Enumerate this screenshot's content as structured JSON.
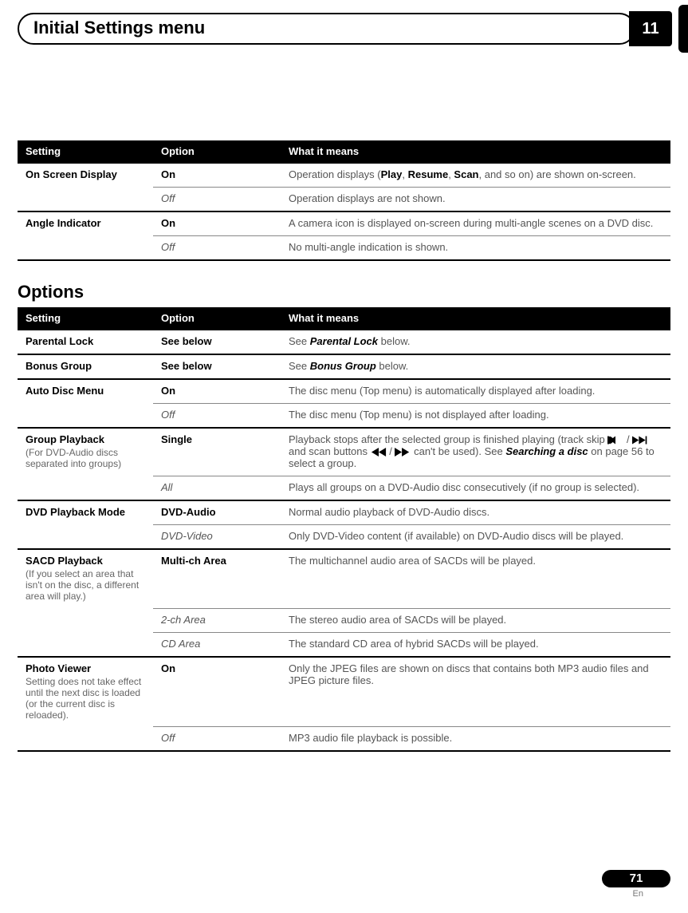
{
  "header": {
    "title": "Initial Settings menu",
    "chapter": "11"
  },
  "table1": {
    "headers": [
      "Setting",
      "Option",
      "What it means"
    ],
    "rows": [
      {
        "setting": "On Screen Display",
        "option": "On",
        "opt_style": "default",
        "meaning_pre": "Operation displays (",
        "b1": "Play",
        "sep1": ", ",
        "b2": "Resume",
        "sep2": ", ",
        "b3": "Scan",
        "meaning_post": ", and so on) are shown on-screen.",
        "new_section": true
      },
      {
        "setting": "",
        "option": "Off",
        "opt_style": "italic",
        "meaning": "Operation displays are not shown.",
        "inner": true
      },
      {
        "setting": "Angle Indicator",
        "option": "On",
        "opt_style": "default",
        "meaning": "A camera icon is displayed on-screen during multi-angle scenes on a DVD disc.",
        "new_section": true
      },
      {
        "setting": "",
        "option": "Off",
        "opt_style": "italic",
        "meaning": "No multi-angle indication is shown.",
        "inner": true
      }
    ]
  },
  "options_heading": "Options",
  "table2": {
    "headers": [
      "Setting",
      "Option",
      "What it means"
    ],
    "rows": [
      {
        "setting": "Parental Lock",
        "option": "See below",
        "opt_style": "default",
        "meaning_pre": "See ",
        "bi": "Parental Lock",
        "meaning_post": " below.",
        "new_section": true
      },
      {
        "setting": "Bonus Group",
        "option": "See below",
        "opt_style": "default",
        "meaning_pre": "See ",
        "bi": "Bonus Group",
        "meaning_post": " below.",
        "new_section": true
      },
      {
        "setting": "Auto Disc Menu",
        "option": "On",
        "opt_style": "default",
        "meaning": "The disc menu (Top menu) is automatically displayed after loading.",
        "new_section": true
      },
      {
        "setting": "",
        "option": "Off",
        "opt_style": "italic",
        "meaning": "The disc menu (Top menu) is not displayed after loading.",
        "inner": true
      },
      {
        "setting": "Group Playback",
        "setting_sub": "(For DVD-Audio discs separated into groups)",
        "option": "Single",
        "opt_style": "default",
        "meaning_pre": "Playback stops after the selected group is finished playing (track skip ",
        "icon1": "skip-back-icon",
        "sep1": " / ",
        "icon2": "skip-fwd-icon",
        "mid": " and scan buttons ",
        "icon3": "scan-back-icon",
        "sep2": " / ",
        "icon4": "scan-fwd-icon",
        "post1": " can't be used). See ",
        "bi": "Searching a disc",
        "post2": " on page 56 to select a group.",
        "new_section": true
      },
      {
        "setting": "",
        "option": "All",
        "opt_style": "italic",
        "meaning": "Plays all groups on a DVD-Audio disc consecutively (if no group is selected).",
        "inner": true
      },
      {
        "setting": "DVD Playback Mode",
        "option": "DVD-Audio",
        "opt_style": "default",
        "meaning": "Normal audio playback of DVD-Audio discs.",
        "new_section": true
      },
      {
        "setting": "",
        "option": "DVD-Video",
        "opt_style": "italic",
        "meaning": "Only DVD-Video content (if available) on DVD-Audio discs will be played.",
        "inner": true
      },
      {
        "setting": "SACD Playback",
        "setting_sub": "(If you select an area that isn't on the disc, a different area will play.)",
        "option": "Multi-ch Area",
        "opt_style": "default",
        "meaning": "The multichannel audio area of SACDs will be played.",
        "new_section": true
      },
      {
        "setting": "",
        "option": "2-ch Area",
        "opt_style": "italic",
        "meaning": "The stereo audio area of SACDs will be played.",
        "inner": true
      },
      {
        "setting": "",
        "option": "CD Area",
        "opt_style": "italic",
        "meaning": "The standard CD area of hybrid SACDs will be played.",
        "inner": true
      },
      {
        "setting": "Photo Viewer",
        "setting_sub": "Setting does not take effect until the next disc is loaded (or the current disc is reloaded).",
        "option": "On",
        "opt_style": "default",
        "meaning": "Only the JPEG files are shown on discs that contains both MP3 audio files and JPEG picture files.",
        "new_section": true
      },
      {
        "setting": "",
        "option": "Off",
        "opt_style": "italic",
        "meaning": "MP3 audio file playback is possible.",
        "inner": true
      }
    ]
  },
  "footer": {
    "page": "71",
    "lang": "En"
  }
}
